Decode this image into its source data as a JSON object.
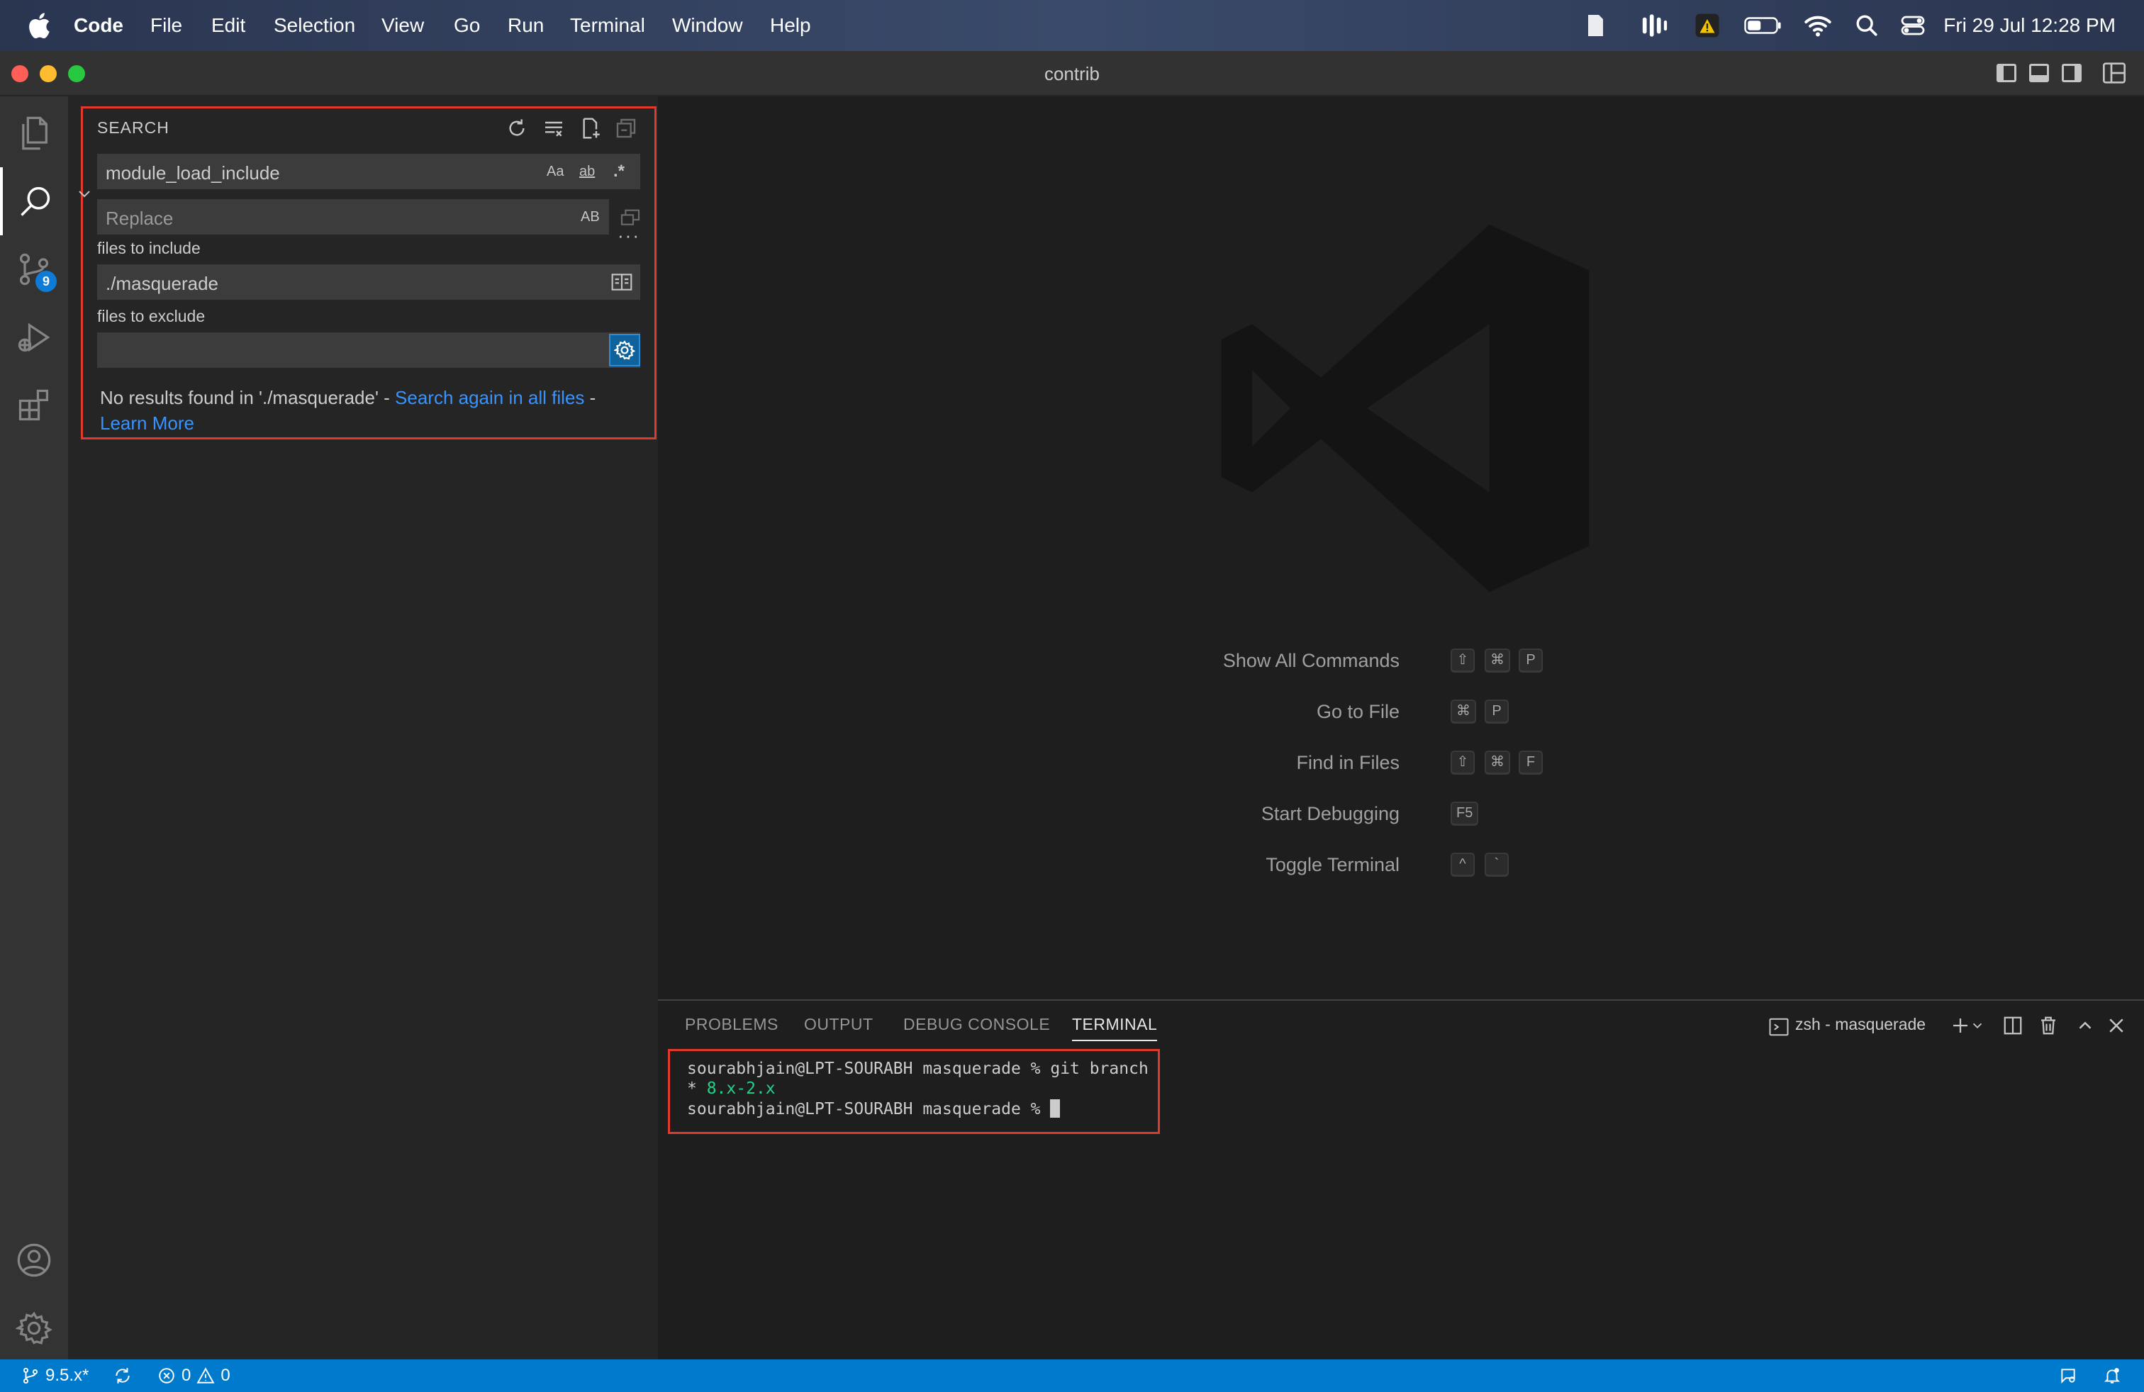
{
  "menubar": {
    "items": [
      "Code",
      "File",
      "Edit",
      "Selection",
      "View",
      "Go",
      "Run",
      "Terminal",
      "Window",
      "Help"
    ],
    "clock": "Fri 29 Jul  12:28 PM"
  },
  "window": {
    "title": "contrib"
  },
  "activitybar": {
    "scm_badge": "9"
  },
  "search": {
    "panel_title": "SEARCH",
    "query": "module_load_include",
    "query_options": [
      "Aa",
      "ab",
      ".*"
    ],
    "replace_placeholder": "Replace",
    "replace_option": "AB",
    "more_label": "···",
    "include_label": "files to include",
    "include_value": "./masquerade",
    "exclude_label": "files to exclude",
    "exclude_value": "",
    "message_prefix": "No results found in './masquerade' - ",
    "search_again_link": "Search again in all files",
    "message_sep": " -",
    "learn_more_link": "Learn More"
  },
  "editor": {
    "shortcuts": [
      {
        "label": "Show All Commands",
        "keys": [
          "⇧",
          "⌘",
          "P"
        ]
      },
      {
        "label": "Go to File",
        "keys": [
          "⌘",
          "P"
        ]
      },
      {
        "label": "Find in Files",
        "keys": [
          "⇧",
          "⌘",
          "F"
        ]
      },
      {
        "label": "Start Debugging",
        "keys": [
          "F5"
        ]
      },
      {
        "label": "Toggle Terminal",
        "keys": [
          "^",
          "`"
        ]
      }
    ]
  },
  "panel": {
    "tabs": [
      "PROBLEMS",
      "OUTPUT",
      "DEBUG CONSOLE",
      "TERMINAL"
    ],
    "active_tab": "TERMINAL",
    "terminal_name": "zsh - masquerade",
    "terminal_lines": {
      "line1": "sourabhjain@LPT-SOURABH masquerade % git branch",
      "line2_prefix": "* ",
      "line2_branch": "8.x-2.x",
      "line3": "sourabhjain@LPT-SOURABH masquerade % "
    }
  },
  "statusbar": {
    "branch": "9.5.x*",
    "errors": "0",
    "warnings": "0"
  },
  "colors": {
    "accent": "#007acc",
    "highlight_box": "#e0392e",
    "link": "#3794ff",
    "terminal_branch": "#23d18b"
  }
}
